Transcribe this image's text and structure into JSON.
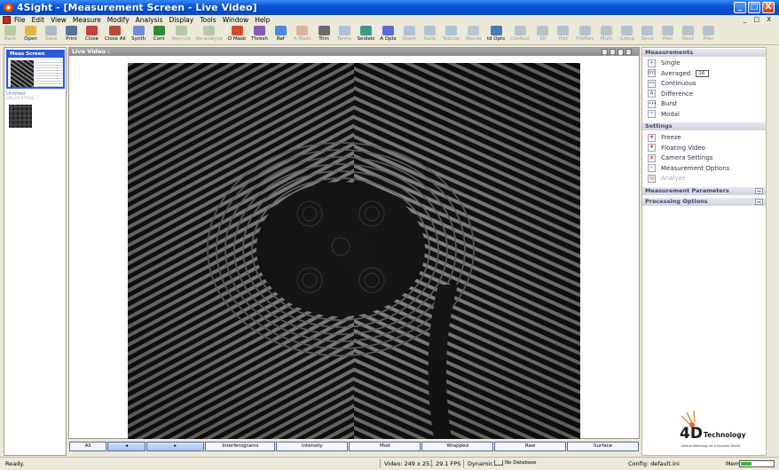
{
  "window": {
    "title": "4Sight - [Measurement Screen - Live Video]",
    "buttons": [
      "_",
      "□",
      "X"
    ]
  },
  "menu": {
    "items": [
      "File",
      "Edit",
      "View",
      "Measure",
      "Modify",
      "Analysis",
      "Display",
      "Tools",
      "Window",
      "Help"
    ],
    "mdi_controls": "_ □ X"
  },
  "toolbar": [
    {
      "label": "Back",
      "disabled": true,
      "color": "#5b8f3a"
    },
    {
      "label": "Open",
      "disabled": false,
      "color": "#e2b640"
    },
    {
      "label": "Save",
      "disabled": true,
      "color": "#3b5ca8"
    },
    {
      "label": "Print",
      "disabled": false,
      "color": "#5b6f9c"
    },
    {
      "label": "Close",
      "disabled": false,
      "color": "#c7413a"
    },
    {
      "label": "Close All",
      "disabled": false,
      "color": "#b84a3a"
    },
    {
      "label": "Synth",
      "disabled": false,
      "color": "#6d8ed8"
    },
    {
      "label": "Cont",
      "disabled": false,
      "color": "#2f8a3a"
    },
    {
      "label": "Recycle",
      "disabled": true,
      "color": "#4f8f4f"
    },
    {
      "label": "Re-analyze",
      "disabled": true,
      "color": "#4f8f4f"
    },
    {
      "label": "D Mask",
      "disabled": false,
      "color": "#d24a2a"
    },
    {
      "label": "Thresh",
      "disabled": false,
      "color": "#8a5ab8"
    },
    {
      "label": "Ref",
      "disabled": false,
      "color": "#4a8ad8"
    },
    {
      "label": "A Mask",
      "disabled": true,
      "color": "#c94a2a"
    },
    {
      "label": "Trim",
      "disabled": false,
      "color": "#6a6a6a"
    },
    {
      "label": "Terms",
      "disabled": true,
      "color": "#3a7ad8"
    },
    {
      "label": "Seidels",
      "disabled": false,
      "color": "#3a9a8a"
    },
    {
      "label": "A Opts",
      "disabled": false,
      "color": "#5a6ad8"
    },
    {
      "label": "Sheet",
      "disabled": true,
      "color": "#3a7ad8"
    },
    {
      "label": "Table",
      "disabled": true,
      "color": "#3a7ad8"
    },
    {
      "label": "Tabular",
      "disabled": true,
      "color": "#3a7ad8"
    },
    {
      "label": "Wands",
      "disabled": true,
      "color": "#5a8ac8"
    },
    {
      "label": "td Opts",
      "disabled": false,
      "color": "#4a7ab8"
    },
    {
      "label": "Contour",
      "disabled": true,
      "color": "#4a7ab8"
    },
    {
      "label": "3D",
      "disabled": true,
      "color": "#4a7ab8"
    },
    {
      "label": "Hist",
      "disabled": true,
      "color": "#4a7ab8"
    },
    {
      "label": "Profiles",
      "disabled": true,
      "color": "#4a7ab8"
    },
    {
      "label": "Multi",
      "disabled": true,
      "color": "#4a7ab8"
    },
    {
      "label": "Group",
      "disabled": true,
      "color": "#4a7ab8"
    },
    {
      "label": "Send",
      "disabled": true,
      "color": "#4a7ab8"
    },
    {
      "label": "Prev",
      "disabled": true,
      "color": "#4a7ab8"
    },
    {
      "label": "Next",
      "disabled": true,
      "color": "#4a7ab8"
    },
    {
      "label": "Play",
      "disabled": true,
      "color": "#4a7ab8"
    }
  ],
  "thumbnails": {
    "active": {
      "title": "Meas Screen"
    },
    "second": {
      "title": "Untitled",
      "subtitle": "EM_C4:87018"
    }
  },
  "video": {
    "header": "Live Video :",
    "controls": [
      "⚲",
      "⚲",
      "S",
      "◂"
    ]
  },
  "tabs": [
    {
      "label": "All",
      "nav": false
    },
    {
      "label": "◂",
      "nav": true
    },
    {
      "label": "▸",
      "nav": true
    },
    {
      "label": "Interferograms",
      "nav": false
    },
    {
      "label": "Intensity",
      "nav": false
    },
    {
      "label": "Mod",
      "nav": false
    },
    {
      "label": "Wrapped",
      "nav": false
    },
    {
      "label": "Raw",
      "nav": false
    },
    {
      "label": "Surface",
      "nav": false
    }
  ],
  "measurements": {
    "header": "Measurements",
    "items": [
      {
        "label": "Single",
        "icon": "•"
      },
      {
        "label": "Averaged",
        "icon": "(n)",
        "value": "16"
      },
      {
        "label": "Continuous",
        "icon": "••"
      },
      {
        "label": "Difference",
        "icon": "∆"
      },
      {
        "label": "Burst",
        "icon": "•••"
      },
      {
        "label": "Modal",
        "icon": "~"
      }
    ]
  },
  "settings": {
    "header": "Settings",
    "items": [
      {
        "label": "Freeze",
        "icon": "✱",
        "disabled": false
      },
      {
        "label": "Floating Video",
        "icon": "✱",
        "disabled": false
      },
      {
        "label": "Camera Settings",
        "icon": "◉",
        "disabled": false
      },
      {
        "label": "Measurement Options",
        "icon": "✓",
        "disabled": false
      },
      {
        "label": "Analyze",
        "icon": "▤",
        "disabled": true
      }
    ]
  },
  "panels": {
    "measurement_parameters": "Measurement Parameters",
    "processing_options": "Processing Options"
  },
  "logo": {
    "brand": "4D",
    "name": "Technology",
    "tagline": "Optical Metrology for a Dynamic World"
  },
  "status": {
    "ready": "Ready.",
    "video": "Video: 249 x 251",
    "fps": "29.1 FPS",
    "mode": "Dynamic",
    "database": "No Database",
    "config": "Config: default.ini",
    "mem_label": "Mem:"
  }
}
